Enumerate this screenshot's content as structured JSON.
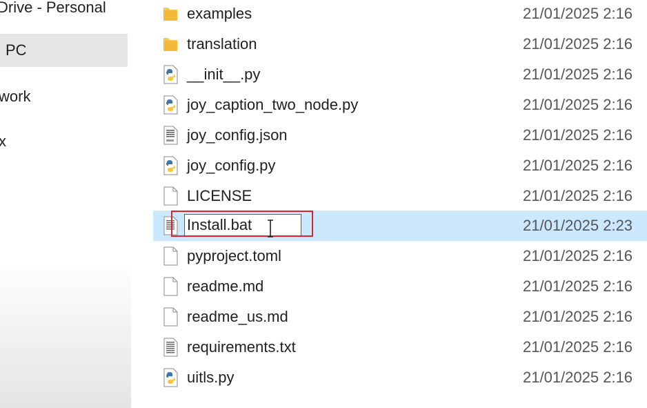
{
  "nav": {
    "items": [
      {
        "label": "Drive - Personal",
        "icon": "onedrive-icon"
      },
      {
        "label": "PC",
        "icon": "this-pc-icon",
        "selected": true
      },
      {
        "label": "work",
        "icon": "network-icon"
      },
      {
        "label": "x",
        "icon": "linux-icon"
      }
    ]
  },
  "files": [
    {
      "name": "examples",
      "date": "21/01/2025 2:16",
      "icon": "folder-icon"
    },
    {
      "name": "translation",
      "date": "21/01/2025 2:16",
      "icon": "folder-icon"
    },
    {
      "name": "__init__.py",
      "date": "21/01/2025 2:16",
      "icon": "python-file-icon"
    },
    {
      "name": "joy_caption_two_node.py",
      "date": "21/01/2025 2:16",
      "icon": "python-file-icon"
    },
    {
      "name": "joy_config.json",
      "date": "21/01/2025 2:16",
      "icon": "json-file-icon"
    },
    {
      "name": "joy_config.py",
      "date": "21/01/2025 2:16",
      "icon": "python-file-icon"
    },
    {
      "name": "LICENSE",
      "date": "21/01/2025 2:16",
      "icon": "blank-file-icon"
    },
    {
      "name": "Install.bat",
      "date": "21/01/2025 2:23",
      "icon": "batch-file-icon",
      "selected": true,
      "renaming": true
    },
    {
      "name": "pyproject.toml",
      "date": "21/01/2025 2:16",
      "icon": "blank-file-icon"
    },
    {
      "name": "readme.md",
      "date": "21/01/2025 2:16",
      "icon": "blank-file-icon"
    },
    {
      "name": "readme_us.md",
      "date": "21/01/2025 2:16",
      "icon": "blank-file-icon"
    },
    {
      "name": "requirements.txt",
      "date": "21/01/2025 2:16",
      "icon": "text-file-icon"
    },
    {
      "name": "uitls.py",
      "date": "21/01/2025 2:16",
      "icon": "python-file-icon"
    }
  ],
  "colors": {
    "selection": "#cce8ff",
    "highlight_frame": "#d9232e",
    "folder": "#f8c854"
  }
}
